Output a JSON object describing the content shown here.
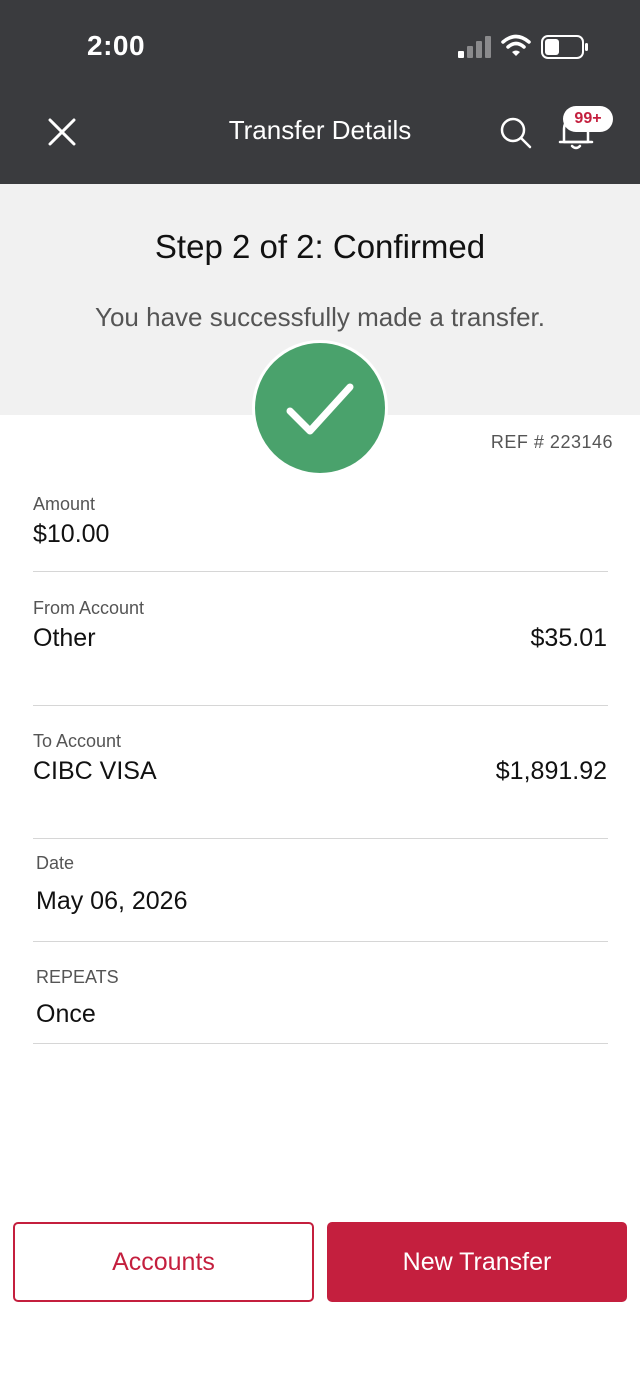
{
  "status_bar": {
    "time": "2:00"
  },
  "header": {
    "title": "Transfer Details",
    "notification_badge": "99+"
  },
  "banner": {
    "step_title": "Step 2 of 2: Confirmed",
    "message": "You have successfully made a transfer."
  },
  "reference": "REF # 223146",
  "details": {
    "amount": {
      "label": "Amount",
      "value": "$10.00"
    },
    "from_account": {
      "label": "From Account",
      "name": "Other",
      "balance": "$35.01"
    },
    "to_account": {
      "label": "To Account",
      "name": "CIBC VISA",
      "balance": "$1,891.92"
    },
    "date": {
      "label": "Date",
      "value": "May 06, 2026"
    },
    "repeats": {
      "label": "REPEATS",
      "value": "Once"
    }
  },
  "actions": {
    "accounts_label": "Accounts",
    "new_transfer_label": "New Transfer"
  },
  "colors": {
    "header_bg": "#3a3b3e",
    "accent": "#c41f3e",
    "success": "#4aa26c",
    "banner_bg": "#f1f1f1"
  },
  "icons": [
    "close-icon",
    "search-icon",
    "bell-icon",
    "checkmark-icon",
    "signal-icon",
    "wifi-icon",
    "battery-icon"
  ]
}
